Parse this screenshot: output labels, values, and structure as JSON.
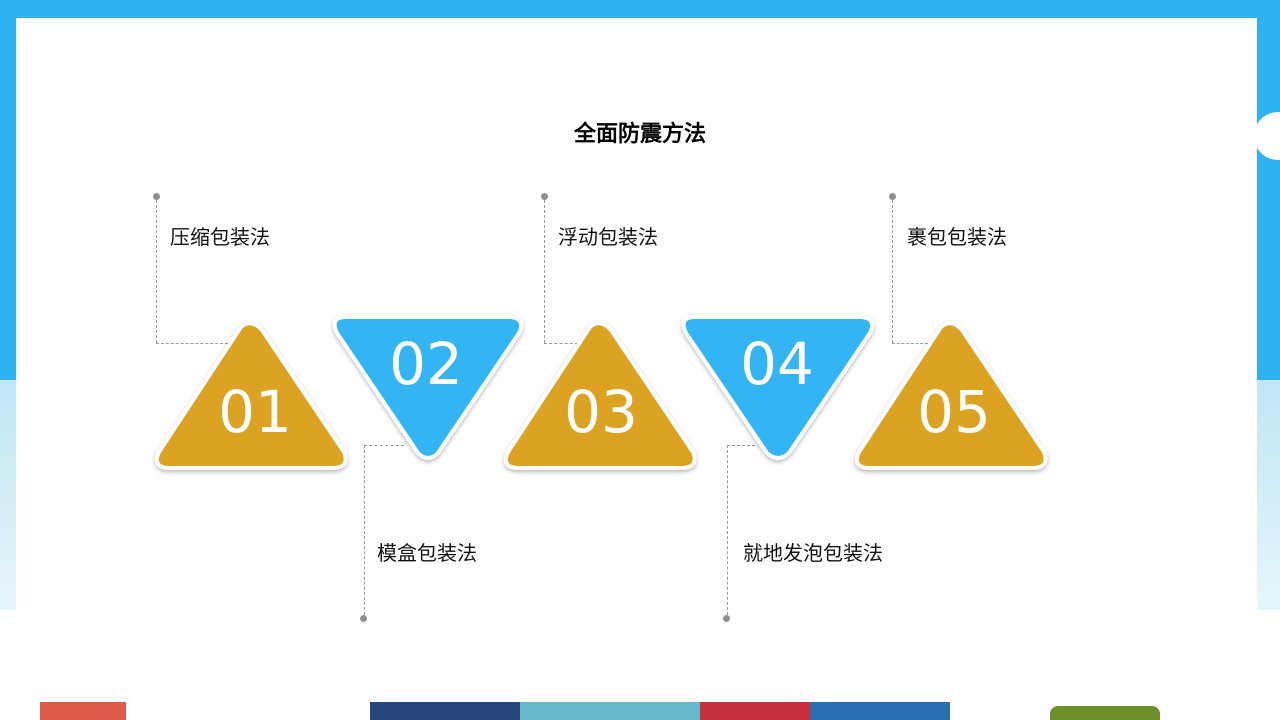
{
  "slide": {
    "title": "全面防震方法"
  },
  "steps": [
    {
      "number": "01",
      "label": "压缩包装法",
      "color": "#dca324"
    },
    {
      "number": "02",
      "label": "模盒包装法",
      "color": "#30b5f2"
    },
    {
      "number": "03",
      "label": "浮动包装法",
      "color": "#dca324"
    },
    {
      "number": "04",
      "label": "就地发泡包装法",
      "color": "#30b5f2"
    },
    {
      "number": "05",
      "label": "裹包包装法",
      "color": "#dca324"
    }
  ],
  "colors": {
    "frame": "#2fb2f2",
    "gold": "#dca324",
    "blue": "#30b5f2",
    "connector": "#9b9b9b"
  }
}
